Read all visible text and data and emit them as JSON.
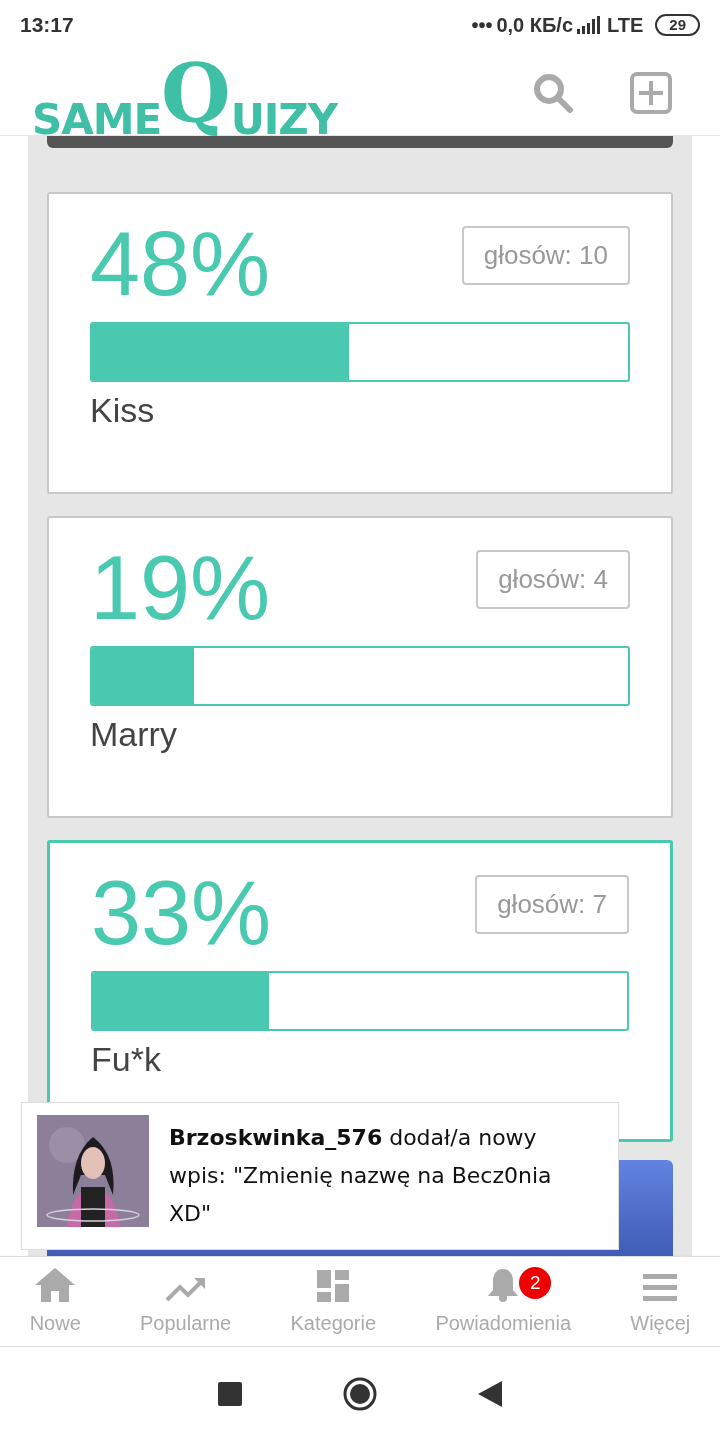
{
  "status_bar": {
    "time": "13:17",
    "dots": "•••",
    "speed": "0,0 КБ/с",
    "network": "LTE",
    "battery": "29"
  },
  "header": {
    "logo_small": "SAME",
    "logo_big": "Q",
    "logo_rest": "UIZY"
  },
  "answers": [
    {
      "percent": "48%",
      "votes": "głosów: 10",
      "level": 0.48,
      "label": "Kiss",
      "selected": false
    },
    {
      "percent": "19%",
      "votes": "głosów: 4",
      "level": 0.19,
      "label": "Marry",
      "selected": false
    },
    {
      "percent": "33%",
      "votes": "głosów: 7",
      "level": 0.33,
      "label": "Fu*k",
      "selected": true
    }
  ],
  "toast": {
    "text": "**Brzoskwinka_576** dodał/a nowy wpis: \"Zmienię nazwę na Becz0nia XD\""
  },
  "bottom_nav": [
    {
      "kind": "home",
      "label": "Nowe"
    },
    {
      "kind": "trend",
      "label": "Popularne"
    },
    {
      "kind": "grid",
      "label": "Kategorie"
    },
    {
      "kind": "bell",
      "label": "Powiadomienia",
      "badge": "2"
    },
    {
      "kind": "menu",
      "label": "Więcej"
    }
  ]
}
